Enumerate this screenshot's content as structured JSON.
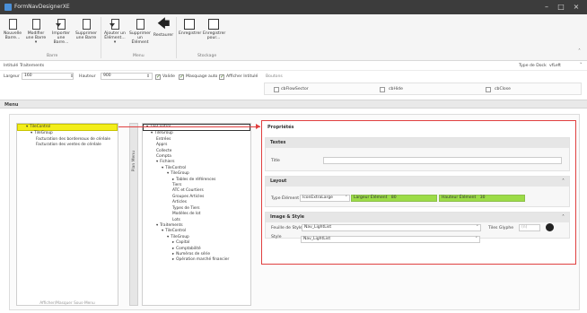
{
  "window": {
    "title": "FormNavDesignerXE",
    "controls": [
      "–",
      "□",
      "×"
    ]
  },
  "ribbon": {
    "buttons": [
      {
        "label": "Nouvelle Barre...",
        "icon": "new-bar-icon"
      },
      {
        "label": "Modifier une Barre ▾",
        "icon": "edit-bar-icon"
      },
      {
        "label": "Importer une Barre...",
        "icon": "import-icon"
      },
      {
        "label": "Supprimer une Barre",
        "icon": "delete-bar-icon"
      },
      {
        "label": "Ajouter un Élément... ▾",
        "icon": "add-element-icon"
      },
      {
        "label": "Supprimer un Élément",
        "icon": "delete-element-icon"
      },
      {
        "label": "Restaurer",
        "icon": "restore-icon"
      },
      {
        "label": "Enregistrer",
        "icon": "save-icon"
      },
      {
        "label": "Enregistrer pour...",
        "icon": "save-for-icon"
      }
    ],
    "groups": [
      "Barre",
      "Menu",
      "Stockage"
    ]
  },
  "form": {
    "intitule_label": "Intitulé",
    "intitule_value": "Traitements",
    "type_label": "Type de Dock",
    "type_value": "vfLeft",
    "largeur_label": "Largeur",
    "largeur_value": "160",
    "hauteur_label": "Hauteur",
    "hauteur_value": "900",
    "valide_label": "Valide",
    "masquage_label": "Masquage auto",
    "afficher_label": "Afficher Intitulé",
    "boutons_label": "Boutons",
    "btn1": "cbFlowSector",
    "btn2": "cbHide",
    "btn3": "cbClose"
  },
  "menu_header": "Menu",
  "left_tree": {
    "items": [
      {
        "text": "TileControl",
        "indent": 1,
        "selected": true,
        "exp": "▾"
      },
      {
        "text": "TileGroup",
        "indent": 2,
        "exp": "▾"
      },
      {
        "text": "Facturation des bordereaux de céréale",
        "indent": 3
      },
      {
        "text": "Facturation des ventes de céréale",
        "indent": 3
      }
    ],
    "footer": "Afficher/Masquer Sous-Menu"
  },
  "vertical_tab": "Plan Menu",
  "middle_tree": {
    "items": [
      {
        "text": "TileControl",
        "indent": 0,
        "exp": "▾",
        "selected": true
      },
      {
        "text": "TileGroup",
        "indent": 1,
        "exp": "▾"
      },
      {
        "text": "Entrées",
        "indent": 2
      },
      {
        "text": "Apprs",
        "indent": 2
      },
      {
        "text": "Collecte",
        "indent": 2
      },
      {
        "text": "Compta",
        "indent": 2
      },
      {
        "text": "Fichiers",
        "indent": 2,
        "exp": "▾"
      },
      {
        "text": "TileControl",
        "indent": 3,
        "exp": "▾"
      },
      {
        "text": "TileGroup",
        "indent": 4,
        "exp": "▾"
      },
      {
        "text": "Tables de références",
        "indent": 5,
        "exp": "▸"
      },
      {
        "text": "Tiers",
        "indent": 5
      },
      {
        "text": "ATC et Courtiers",
        "indent": 5
      },
      {
        "text": "Groupes Articles",
        "indent": 5
      },
      {
        "text": "Articles",
        "indent": 5
      },
      {
        "text": "Types de Tiers",
        "indent": 5
      },
      {
        "text": "Modèles de lot",
        "indent": 5
      },
      {
        "text": "Lots",
        "indent": 5
      },
      {
        "text": "Traitements",
        "indent": 2,
        "exp": "▾"
      },
      {
        "text": "TileControl",
        "indent": 3,
        "exp": "▾"
      },
      {
        "text": "TileGroup",
        "indent": 4,
        "exp": "▾"
      },
      {
        "text": "Capital",
        "indent": 5,
        "exp": "▸"
      },
      {
        "text": "Comptabilité",
        "indent": 5,
        "exp": "▸"
      },
      {
        "text": "Numéros de série",
        "indent": 5,
        "exp": "▸"
      },
      {
        "text": "Opération marché financier",
        "indent": 5,
        "exp": "▸"
      }
    ]
  },
  "properties": {
    "header": "Propriétés",
    "textes": {
      "title": "Textes",
      "titre_label": "Title",
      "titre_value": ""
    },
    "layout": {
      "title": "Layout",
      "type_label": "Type Élément",
      "type_value": "IconExtraLarge",
      "largeur_label": "Largeur Élément",
      "largeur_value": "80",
      "hauteur_label": "Hauteur Élément",
      "hauteur_value": "30"
    },
    "image_style": {
      "title": "Image & Style",
      "feuille_label": "Feuille de Styles",
      "feuille_value": "Nav_LightList",
      "style_label": "Style",
      "style_value": "Nav_LightList",
      "glyph_label": "Tiles Glyphe",
      "glyph_value": "(n)"
    }
  }
}
